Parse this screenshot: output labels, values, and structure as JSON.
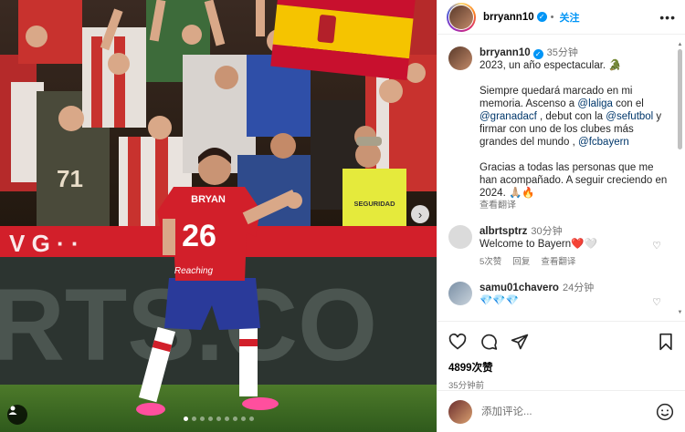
{
  "post": {
    "photo": {
      "jersey_name": "BRYAN",
      "jersey_number": "26",
      "sponsor_text": "Reaching",
      "bib_text": "SEGURIDAD",
      "fan_shirt_number": "71",
      "banner_text": "RTS.CO",
      "image_count": 9,
      "active_index": 0
    }
  },
  "header": {
    "username": "brryann10",
    "follow_label": "关注"
  },
  "caption": {
    "username": "brryann10",
    "time": "35分钟",
    "line1": "2023, un año espectacular. 🐊",
    "p2_a": "Siempre quedará marcado en mi memoria. Ascenso a ",
    "m_laliga": "@laliga",
    "p2_b": " con el ",
    "m_granada": "@granadacf",
    "p2_c": " , debut con la ",
    "m_sefutbol": "@sefutbol",
    "p2_d": " y firmar con uno de los clubes más grandes del mundo , ",
    "m_fcbayern": "@fcbayern",
    "p3": "Gracias a todas las personas que me han acompañado. A seguir creciendo en 2024. 🙏🏼🔥",
    "see_translation": "查看翻译"
  },
  "comments": [
    {
      "username": "albrtsptrz",
      "time": "30分钟",
      "text": "Welcome to Bayern❤️🤍",
      "likes": "5次赞",
      "reply": "回复",
      "translate": "查看翻译"
    },
    {
      "username": "samu01chavero",
      "time": "24分钟",
      "text": "💎💎💎"
    }
  ],
  "stats": {
    "likes": "4899次赞",
    "posted": "35分钟前"
  },
  "comment_input": {
    "placeholder": "添加评论..."
  },
  "icons": {
    "like": "heart-icon",
    "comment": "comment-icon",
    "share": "share-icon",
    "save": "bookmark-icon",
    "more": "more-icon",
    "emoji": "emoji-icon",
    "tag": "user-tag-icon",
    "next": "chevron-right-icon"
  },
  "colors": {
    "accent": "#0095f6",
    "mention": "#00376b",
    "muted": "#737373",
    "granada_red": "#d81f2a",
    "spain_yellow": "#f5c400"
  }
}
